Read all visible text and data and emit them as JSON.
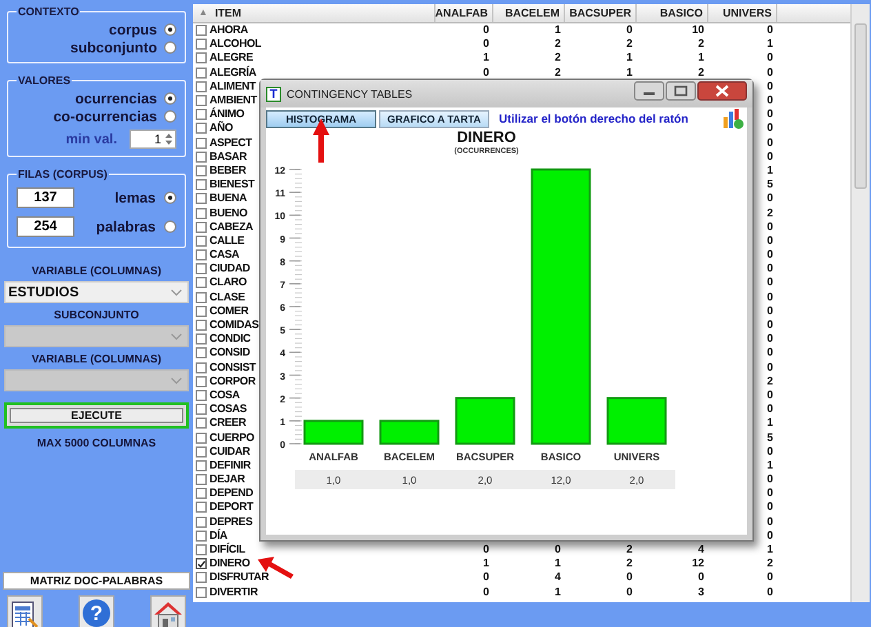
{
  "left_panel": {
    "contexto": {
      "title": "CONTEXTO",
      "options": [
        {
          "label": "corpus",
          "selected": true
        },
        {
          "label": "subconjunto",
          "selected": false
        }
      ]
    },
    "valores": {
      "title": "VALORES",
      "options": [
        {
          "label": "ocurrencias",
          "selected": true
        },
        {
          "label": "co-ocurrencias",
          "selected": false
        }
      ],
      "min_val": {
        "label": "min val.",
        "value": "1"
      }
    },
    "filas": {
      "title": "FILAS (CORPUS)",
      "options": [
        {
          "count": "137",
          "label": "lemas",
          "selected": true
        },
        {
          "count": "254",
          "label": "palabras",
          "selected": false
        }
      ]
    },
    "selects": [
      {
        "label": "VARIABLE (COLUMNAS)",
        "value": "ESTUDIOS",
        "disabled": false
      },
      {
        "label": "SUBCONJUNTO",
        "disabled": true
      },
      {
        "label": "VARIABLE (COLUMNAS)",
        "disabled": true
      }
    ],
    "execute_button": "EJECUTE",
    "note": "MAX 5000 COLUMNAS",
    "matrix_button": "MATRIZ DOC-PALABRAS",
    "help_glyph": "?"
  },
  "table": {
    "sort_glyph": "▲",
    "columns": [
      "ITEM",
      "ANALFAB",
      "BACELEM",
      "BACSUPER",
      "BASICO",
      "UNIVERS"
    ],
    "rows": [
      {
        "checked": false,
        "cells": [
          "AHORA",
          "0",
          "1",
          "0",
          "10",
          "0"
        ]
      },
      {
        "checked": false,
        "cells": [
          "ALCOHOL",
          "0",
          "2",
          "2",
          "2",
          "1"
        ]
      },
      {
        "checked": false,
        "cells": [
          "ALEGRE",
          "1",
          "2",
          "1",
          "1",
          "0"
        ]
      },
      {
        "checked": false,
        "cells": [
          "ALEGRÍA",
          "0",
          "2",
          "1",
          "2",
          "0"
        ]
      },
      {
        "checked": false,
        "cells": [
          "ALIMENT",
          null,
          null,
          null,
          null,
          "0"
        ]
      },
      {
        "checked": false,
        "cells": [
          "AMBIENT",
          null,
          null,
          null,
          null,
          "0"
        ]
      },
      {
        "checked": false,
        "cells": [
          "ÁNIMO",
          null,
          null,
          null,
          null,
          "0"
        ]
      },
      {
        "checked": false,
        "cells": [
          "AÑO",
          null,
          null,
          null,
          null,
          "0"
        ]
      },
      {
        "checked": false,
        "cells": [
          "ASPECT",
          null,
          null,
          null,
          null,
          "0"
        ]
      },
      {
        "checked": false,
        "cells": [
          "BASAR",
          null,
          null,
          null,
          null,
          "0"
        ]
      },
      {
        "checked": false,
        "cells": [
          "BEBER",
          null,
          null,
          null,
          null,
          "1"
        ]
      },
      {
        "checked": false,
        "cells": [
          "BIENEST",
          null,
          null,
          null,
          null,
          "5"
        ]
      },
      {
        "checked": false,
        "cells": [
          "BUENA",
          null,
          null,
          null,
          null,
          "0"
        ]
      },
      {
        "checked": false,
        "cells": [
          "BUENO",
          null,
          null,
          null,
          null,
          "2"
        ]
      },
      {
        "checked": false,
        "cells": [
          "CABEZA",
          null,
          null,
          null,
          null,
          "0"
        ]
      },
      {
        "checked": false,
        "cells": [
          "CALLE",
          null,
          null,
          null,
          null,
          "0"
        ]
      },
      {
        "checked": false,
        "cells": [
          "CASA",
          null,
          null,
          null,
          null,
          "0"
        ]
      },
      {
        "checked": false,
        "cells": [
          "CIUDAD",
          null,
          null,
          null,
          null,
          "0"
        ]
      },
      {
        "checked": false,
        "cells": [
          "CLARO",
          null,
          null,
          null,
          null,
          "0"
        ]
      },
      {
        "checked": false,
        "cells": [
          "CLASE",
          null,
          null,
          null,
          null,
          "0"
        ]
      },
      {
        "checked": false,
        "cells": [
          "COMER",
          null,
          null,
          null,
          null,
          "0"
        ]
      },
      {
        "checked": false,
        "cells": [
          "COMIDAS",
          null,
          null,
          null,
          null,
          "0"
        ]
      },
      {
        "checked": false,
        "cells": [
          "CONDIC",
          null,
          null,
          null,
          null,
          "0"
        ]
      },
      {
        "checked": false,
        "cells": [
          "CONSID",
          null,
          null,
          null,
          null,
          "0"
        ]
      },
      {
        "checked": false,
        "cells": [
          "CONSIST",
          null,
          null,
          null,
          null,
          "0"
        ]
      },
      {
        "checked": false,
        "cells": [
          "CORPOR",
          null,
          null,
          null,
          null,
          "2"
        ]
      },
      {
        "checked": false,
        "cells": [
          "COSA",
          null,
          null,
          null,
          null,
          "0"
        ]
      },
      {
        "checked": false,
        "cells": [
          "COSAS",
          null,
          null,
          null,
          null,
          "0"
        ]
      },
      {
        "checked": false,
        "cells": [
          "CREER",
          null,
          null,
          null,
          null,
          "1"
        ]
      },
      {
        "checked": false,
        "cells": [
          "CUERPO",
          null,
          null,
          null,
          null,
          "5"
        ]
      },
      {
        "checked": false,
        "cells": [
          "CUIDAR",
          null,
          null,
          null,
          null,
          "0"
        ]
      },
      {
        "checked": false,
        "cells": [
          "DEFINIR",
          null,
          null,
          null,
          null,
          "1"
        ]
      },
      {
        "checked": false,
        "cells": [
          "DEJAR",
          null,
          null,
          null,
          null,
          "0"
        ]
      },
      {
        "checked": false,
        "cells": [
          "DEPEND",
          null,
          null,
          null,
          null,
          "0"
        ]
      },
      {
        "checked": false,
        "cells": [
          "DEPORT",
          null,
          null,
          null,
          null,
          "0"
        ]
      },
      {
        "checked": false,
        "cells": [
          "DEPRES",
          null,
          null,
          null,
          null,
          "0"
        ]
      },
      {
        "checked": false,
        "cells": [
          "DÍA",
          null,
          null,
          null,
          null,
          "0"
        ]
      },
      {
        "checked": false,
        "cells": [
          "DIFÍCIL",
          "0",
          "0",
          "2",
          "4",
          "1"
        ]
      },
      {
        "checked": true,
        "cells": [
          "DINERO",
          "1",
          "1",
          "2",
          "12",
          "2"
        ]
      },
      {
        "checked": false,
        "cells": [
          "DISFRUTAR",
          "0",
          "4",
          "0",
          "0",
          "0"
        ]
      },
      {
        "checked": false,
        "cells": [
          "DIVERTIR",
          "0",
          "1",
          "0",
          "3",
          "0"
        ]
      }
    ]
  },
  "modal": {
    "icon_letter": "T",
    "title": "CONTINGENCY TABLES",
    "tabs": [
      {
        "label": "HISTOGRAMA",
        "selected": true
      },
      {
        "label": "GRAFICO A TARTA",
        "selected": false
      }
    ],
    "hint": "Utilizar el botón derecho del ratón",
    "subtitle": "(OCCURRENCES)",
    "chart_data": {
      "type": "bar",
      "title": "DINERO",
      "categories": [
        "ANALFAB",
        "BACELEM",
        "BACSUPER",
        "BASICO",
        "UNIVERS"
      ],
      "values": [
        1,
        1,
        2,
        12,
        2
      ],
      "yticks": [
        0,
        1,
        2,
        3,
        4,
        5,
        6,
        7,
        8,
        9,
        10,
        11,
        12
      ],
      "ylim": [
        0,
        12
      ]
    },
    "value_row": [
      "1,0",
      "1,0",
      "2,0",
      "12,0",
      "2,0"
    ]
  }
}
